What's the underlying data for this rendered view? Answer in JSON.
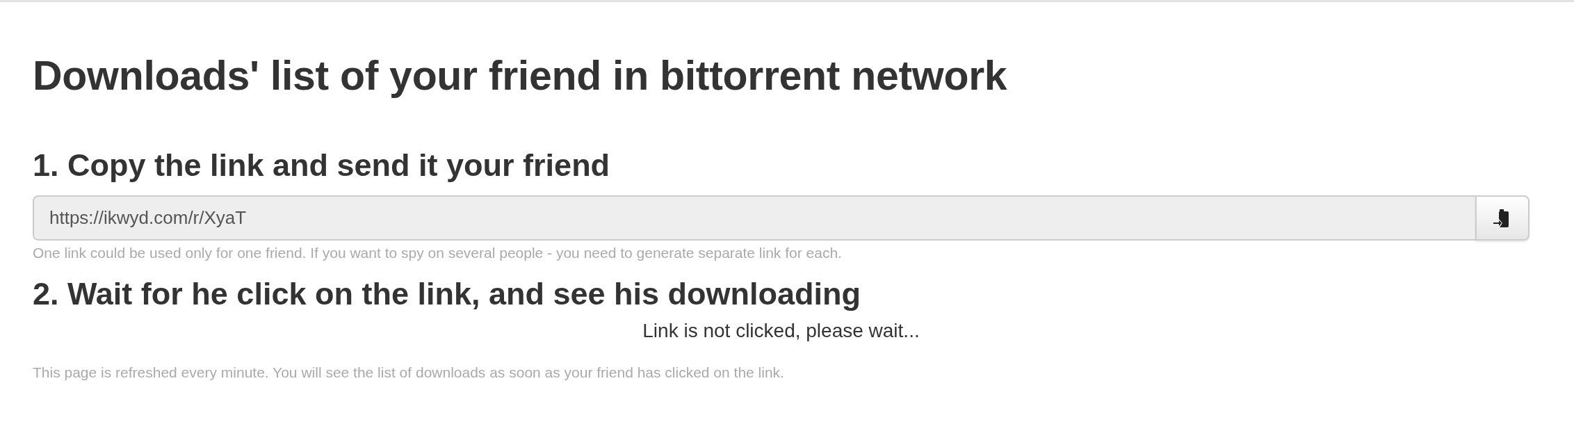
{
  "title": "Downloads' list of your friend in bittorrent network",
  "step_1": {
    "heading": "1. Copy the link and send it your friend",
    "link_field": {
      "value": "https://ikwyd.com/r/XyaT"
    },
    "help": "One link could be used only for one friend. If you want to spy on several people - you need to generate separate link for each."
  },
  "step_2": {
    "heading": "2. Wait for he click on the link, and see his downloading",
    "status": "Link is not clicked, please wait...",
    "note": "This page is refreshed every minute. You will see the list of downloads as soon as your friend has clicked on the link."
  }
}
